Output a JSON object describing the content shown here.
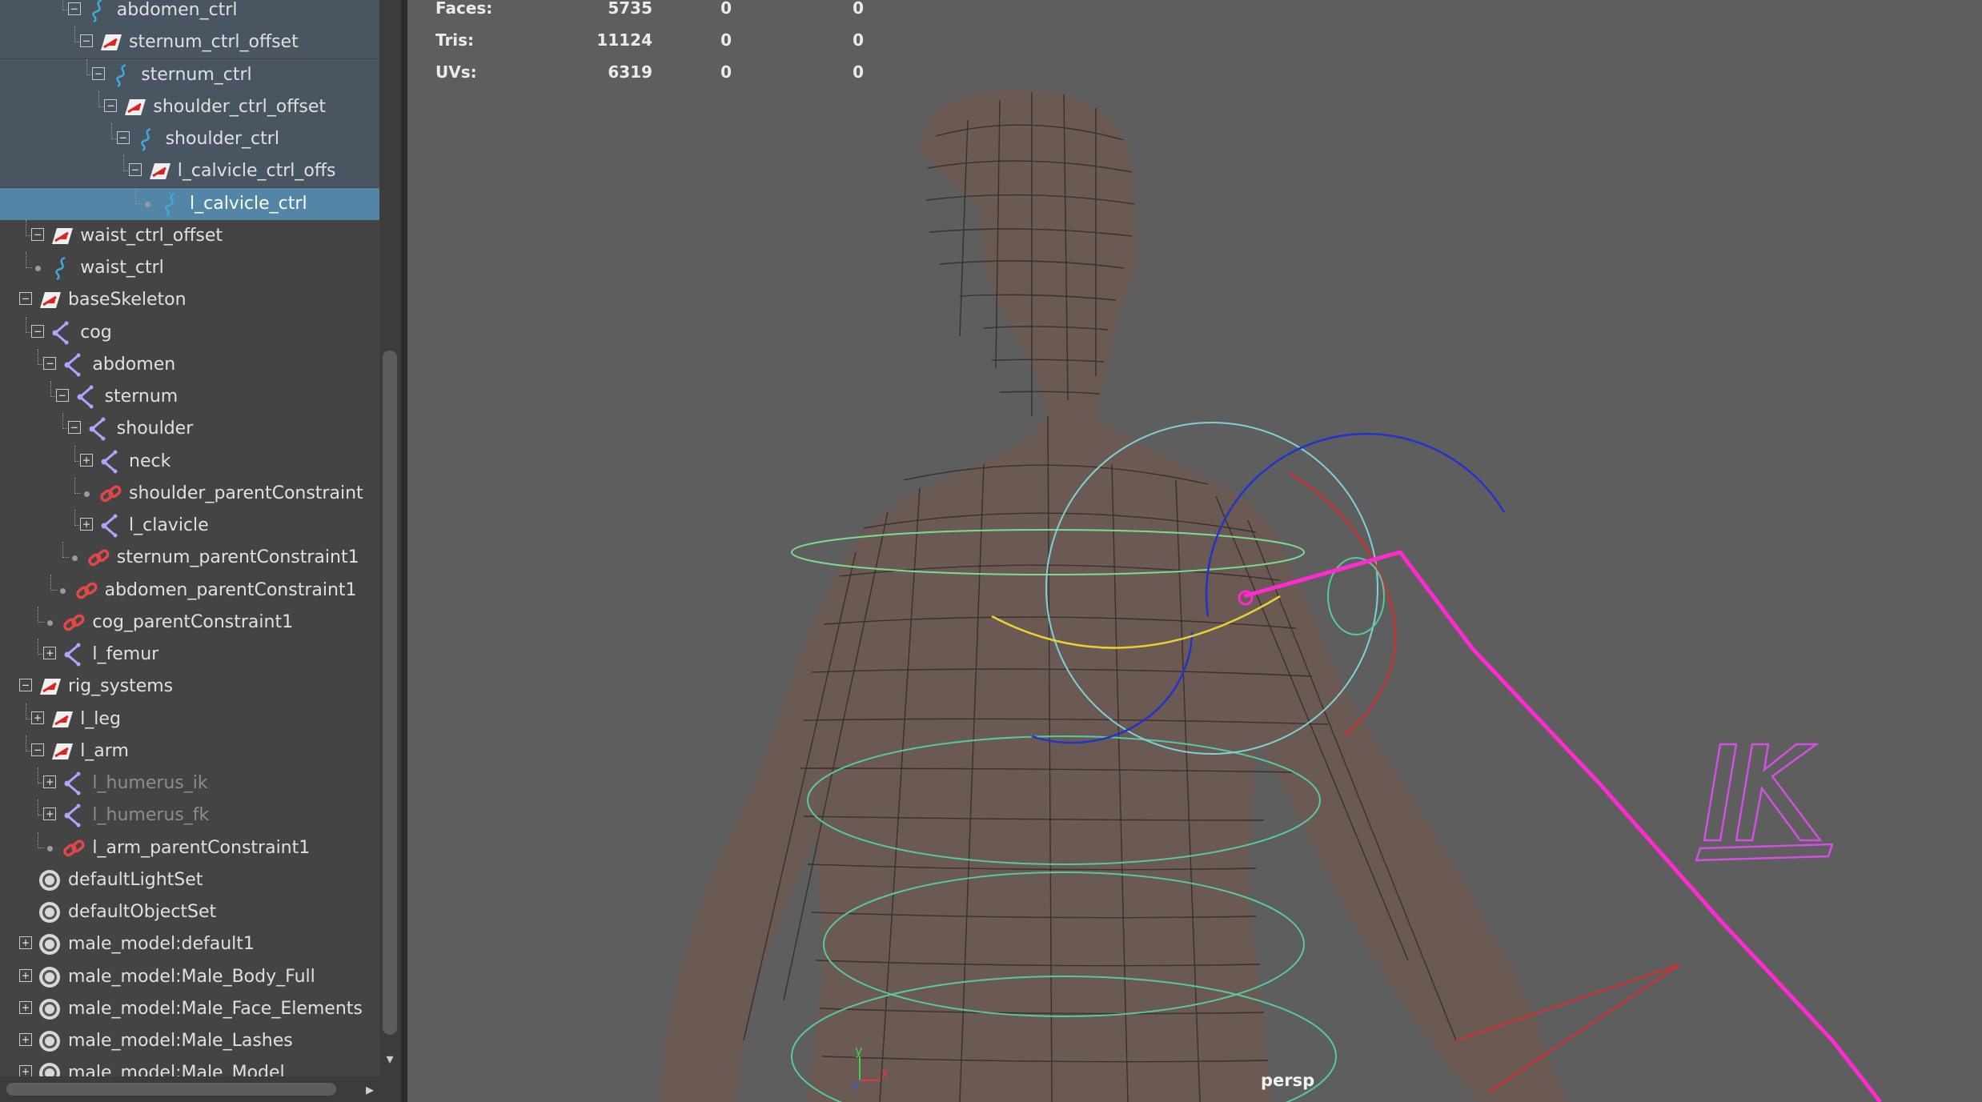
{
  "outliner": {
    "items": [
      {
        "label": "abdomen_ctrl",
        "icon": "nurbs-curve-icon"
      },
      {
        "label": "sternum_ctrl_offset",
        "icon": "transform-group-icon"
      },
      {
        "label": "sternum_ctrl",
        "icon": "nurbs-curve-icon"
      },
      {
        "label": "shoulder_ctrl_offset",
        "icon": "transform-group-icon"
      },
      {
        "label": "shoulder_ctrl",
        "icon": "nurbs-curve-icon"
      },
      {
        "label": "l_calvicle_ctrl_offs",
        "icon": "transform-group-icon"
      },
      {
        "label": "l_calvicle_ctrl",
        "icon": "nurbs-curve-icon",
        "selected": true
      },
      {
        "label": "waist_ctrl_offset",
        "icon": "transform-group-icon"
      },
      {
        "label": "waist_ctrl",
        "icon": "nurbs-curve-icon"
      },
      {
        "label": "baseSkeleton",
        "icon": "transform-group-icon"
      },
      {
        "label": "cog",
        "icon": "joint-icon"
      },
      {
        "label": "abdomen",
        "icon": "joint-icon"
      },
      {
        "label": "sternum",
        "icon": "joint-icon"
      },
      {
        "label": "shoulder",
        "icon": "joint-icon"
      },
      {
        "label": "neck",
        "icon": "joint-icon"
      },
      {
        "label": "shoulder_parentConstraint",
        "icon": "constraint-icon"
      },
      {
        "label": "l_clavicle",
        "icon": "joint-icon"
      },
      {
        "label": "sternum_parentConstraint1",
        "icon": "constraint-icon"
      },
      {
        "label": "abdomen_parentConstraint1",
        "icon": "constraint-icon"
      },
      {
        "label": "cog_parentConstraint1",
        "icon": "constraint-icon"
      },
      {
        "label": "l_femur",
        "icon": "joint-icon"
      },
      {
        "label": "rig_systems",
        "icon": "transform-group-icon"
      },
      {
        "label": "l_leg",
        "icon": "transform-group-icon"
      },
      {
        "label": "l_arm",
        "icon": "transform-group-icon"
      },
      {
        "label": "l_humerus_ik",
        "icon": "joint-icon",
        "dim": true
      },
      {
        "label": "l_humerus_fk",
        "icon": "joint-icon",
        "dim": true
      },
      {
        "label": "l_arm_parentConstraint1",
        "icon": "constraint-icon"
      },
      {
        "label": "defaultLightSet",
        "icon": "object-set-icon"
      },
      {
        "label": "defaultObjectSet",
        "icon": "object-set-icon"
      },
      {
        "label": "male_model:default1",
        "icon": "object-set-icon"
      },
      {
        "label": "male_model:Male_Body_Full",
        "icon": "object-set-icon"
      },
      {
        "label": "male_model:Male_Face_Elements",
        "icon": "object-set-icon"
      },
      {
        "label": "male_model:Male_Lashes",
        "icon": "object-set-icon"
      },
      {
        "label": "male_model:Male_Model",
        "icon": "object-set-icon"
      }
    ]
  },
  "viewport": {
    "stats": [
      {
        "label": "Faces:",
        "values": [
          "5735",
          "0",
          "0"
        ]
      },
      {
        "label": "Tris:",
        "values": [
          "11124",
          "0",
          "0"
        ]
      },
      {
        "label": "UVs:",
        "values": [
          "6319",
          "0",
          "0"
        ]
      }
    ],
    "camera_label": "persp",
    "axis": {
      "y": "y",
      "x": "x"
    },
    "ik_label": "IK"
  },
  "colors": {
    "outliner_bg": "#444444",
    "selection": "#5285a6",
    "viewport_bg": "#5e5e5e",
    "curve_icon": "#3fa9d8",
    "joint_icon": "#b3a3ff",
    "constraint_icon": "#e04848"
  }
}
